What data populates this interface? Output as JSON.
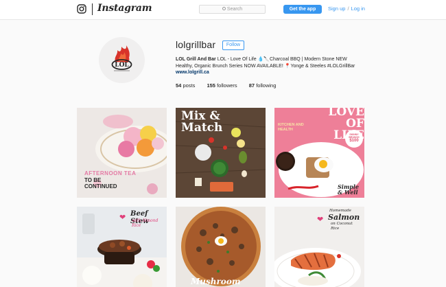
{
  "nav": {
    "wordmark": "Instagram",
    "search_placeholder": "Search",
    "get_app_label": "Get the app",
    "signup_label": "Sign up",
    "separator": "/",
    "login_label": "Log in"
  },
  "profile": {
    "username": "lolgrillbar",
    "follow_label": "Follow",
    "full_name": "LOL Grill And Bar",
    "bio_line1": "LOL - Love Of Life 💧🔪Charcoal BBQ | Modern Stone NEW",
    "bio_line2": "Healthy, Organic Brunch Series NOW AVAILABLE! 📍Yonge & Steeles #LOLGrillBar",
    "website": "www.lolgrill.ca",
    "stats": {
      "posts_count": "54",
      "posts_label": "posts",
      "followers_count": "155",
      "followers_label": "followers",
      "following_count": "87",
      "following_label": "following"
    }
  },
  "posts": [
    {
      "caption": "AFTERNOON TEA",
      "caption2": "TO BE CONTINUED"
    },
    {
      "caption": "Mix & Match"
    },
    {
      "caption": "LOVE OF LIFE",
      "caption2": "KITCHEN AND HEALTH",
      "badge": "SKINNY BRUNCH",
      "badge_price": "$100",
      "script": "Simple & Well"
    },
    {
      "caption": "Beef Stew",
      "caption2": "with Almond Rice"
    },
    {
      "caption": "Mushroom"
    },
    {
      "caption": "Salmon",
      "caption2": "on Coconut Rice",
      "pre": "Homemade"
    }
  ],
  "colors": {
    "accent": "#3897f0",
    "text": "#262626",
    "link": "#003569"
  },
  "icons": {
    "logo": "instagram-glyph-icon",
    "search": "search-icon",
    "avatar_logo": "lol-flame-logo"
  }
}
